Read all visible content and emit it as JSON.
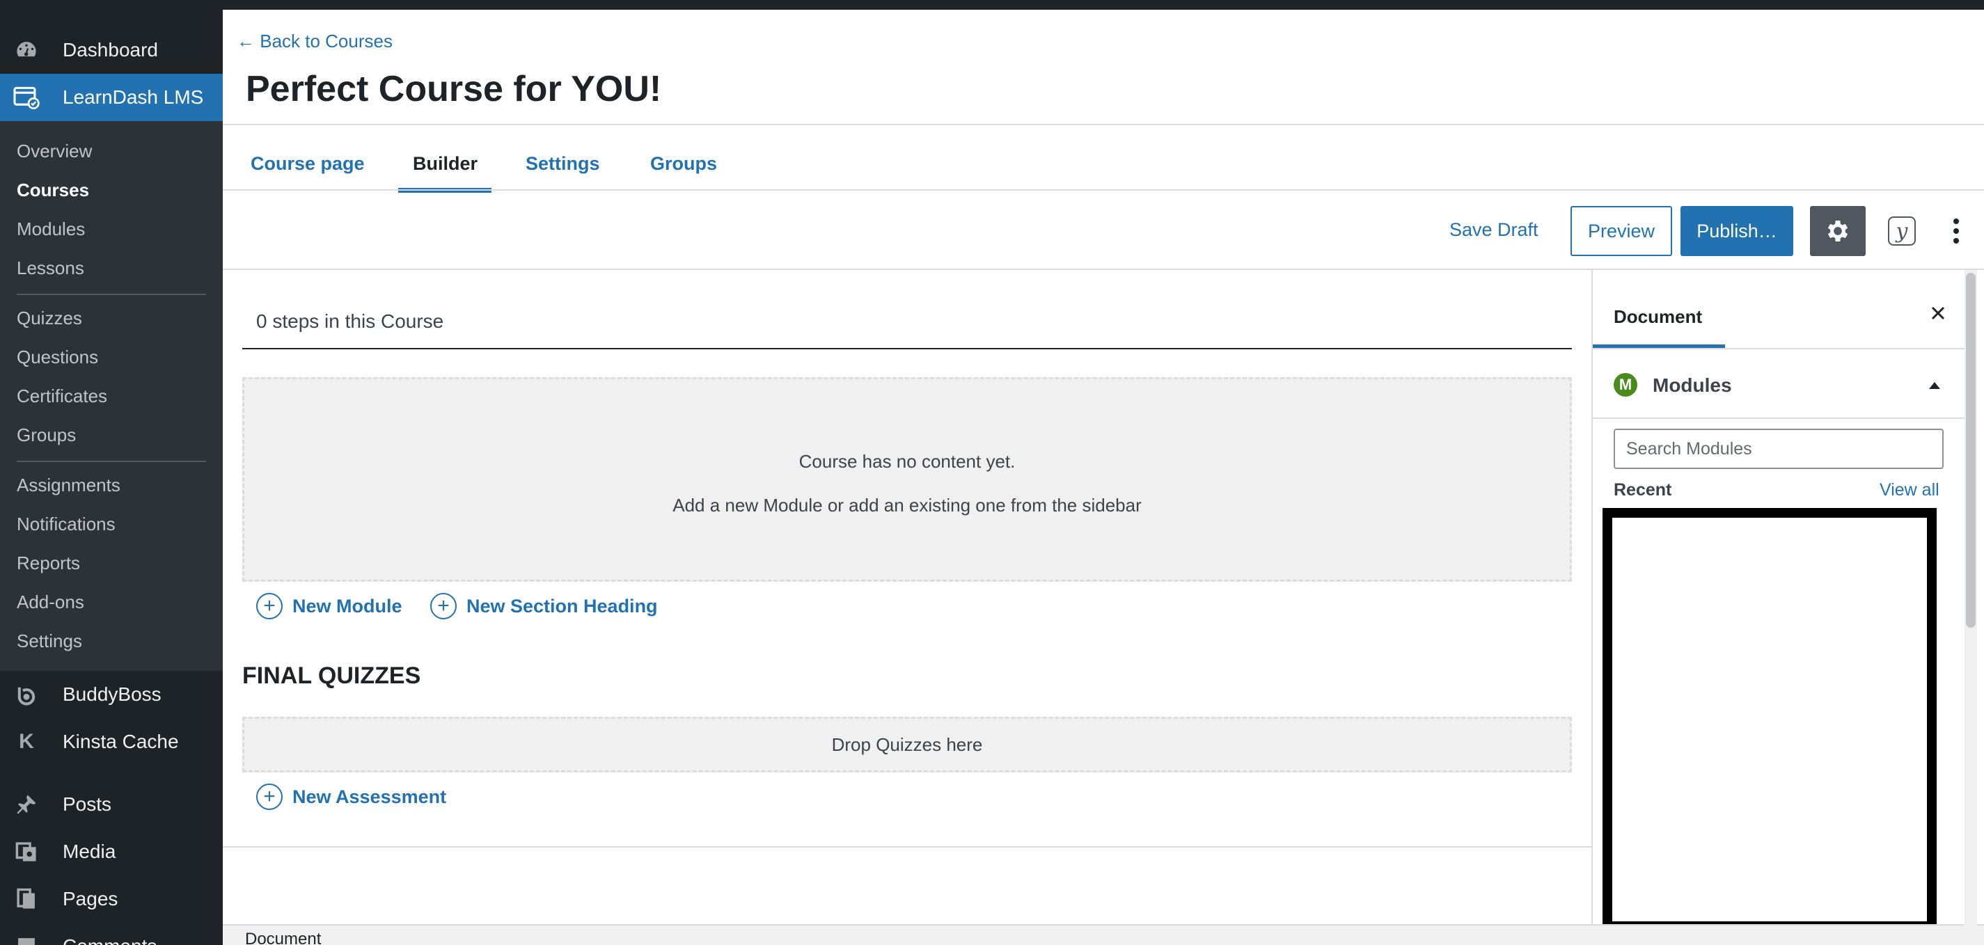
{
  "admin_menu": {
    "dashboard": "Dashboard",
    "learndash": "LearnDash LMS",
    "submenu": {
      "overview": "Overview",
      "courses": "Courses",
      "modules": "Modules",
      "lessons": "Lessons",
      "quizzes": "Quizzes",
      "questions": "Questions",
      "certificates": "Certificates",
      "groups": "Groups",
      "assignments": "Assignments",
      "notifications": "Notifications",
      "reports": "Reports",
      "addons": "Add-ons",
      "settings": "Settings"
    },
    "buddyboss": "BuddyBoss",
    "kinsta": "Kinsta Cache",
    "posts": "Posts",
    "media": "Media",
    "pages": "Pages",
    "comments": "Comments"
  },
  "header": {
    "back_link": "← Back to Courses",
    "title": "Perfect Course for YOU!"
  },
  "tabs": [
    "Course page",
    "Builder",
    "Settings",
    "Groups"
  ],
  "toolbar": {
    "save_draft": "Save Draft",
    "preview": "Preview",
    "publish": "Publish…"
  },
  "builder": {
    "steps": "0 steps in this Course",
    "empty_title": "Course has no content yet.",
    "empty_hint": "Add a new Module or add an existing one from the sidebar",
    "new_module": "New Module",
    "new_section_heading": "New Section Heading",
    "final_quizzes_heading": "FINAL QUIZZES",
    "drop_quizzes": "Drop Quizzes here",
    "new_assessment": "New Assessment"
  },
  "sidebar_panel": {
    "tab": "Document",
    "section_badge": "M",
    "section_title": "Modules",
    "search_placeholder": "Search Modules",
    "recent_label": "Recent",
    "view_all": "View all"
  },
  "footer": {
    "label": "Document"
  },
  "colors": {
    "accent": "#2271b1",
    "sidebar_bg": "#1d2327",
    "submenu_bg": "#2c3338",
    "module_badge": "#4a8c1c"
  }
}
